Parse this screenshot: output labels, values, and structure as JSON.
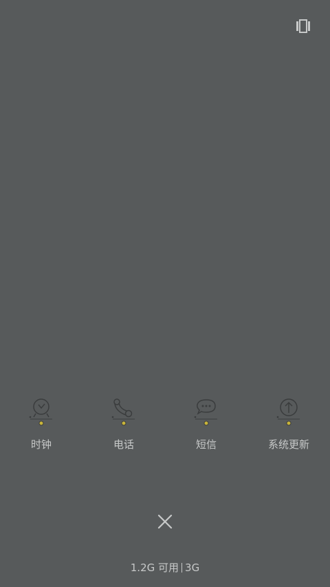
{
  "top_right_icon": "recent-apps-view-icon",
  "apps": [
    {
      "label": "时钟",
      "icon": "clock-icon"
    },
    {
      "label": "电话",
      "icon": "phone-icon"
    },
    {
      "label": "短信",
      "icon": "message-icon"
    },
    {
      "label": "系统更新",
      "icon": "system-update-icon"
    }
  ],
  "close_icon": "close-icon",
  "memory": {
    "available": "1.2G",
    "available_label": "可用",
    "total": "3G"
  },
  "colors": {
    "background": "#575a5b",
    "icon_stroke": "#3a3c3d",
    "indicator": "#c8b43a",
    "text": "#c7c9c9"
  }
}
